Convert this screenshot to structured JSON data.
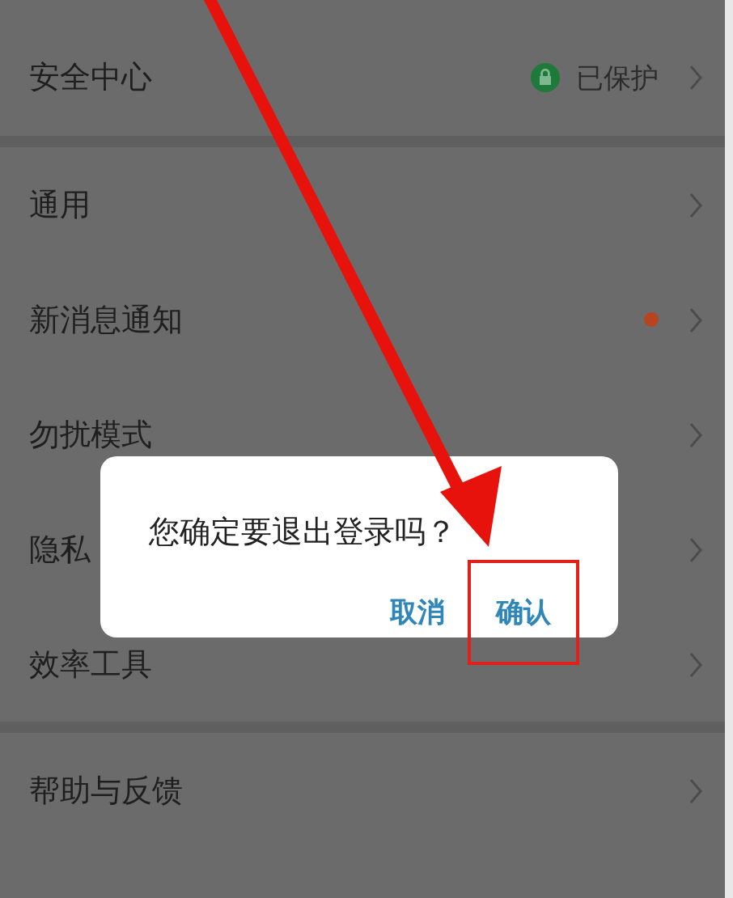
{
  "settings": {
    "groups": [
      {
        "items": [
          {
            "label": "安全中心",
            "kind": "status",
            "status": "已保护"
          }
        ]
      },
      {
        "items": [
          {
            "label": "通用",
            "kind": "plain"
          },
          {
            "label": "新消息通知",
            "kind": "dot"
          },
          {
            "label": "勿扰模式",
            "kind": "plain"
          },
          {
            "label": "隐私",
            "kind": "plain"
          },
          {
            "label": "效率工具",
            "kind": "plain"
          }
        ]
      },
      {
        "items": [
          {
            "label": "帮助与反馈",
            "kind": "plain"
          }
        ]
      }
    ]
  },
  "dialog": {
    "message": "您确定要退出登录吗？",
    "buttons": [
      {
        "label": "取消",
        "highlighted": false
      },
      {
        "label": "确认",
        "highlighted": true
      }
    ]
  }
}
